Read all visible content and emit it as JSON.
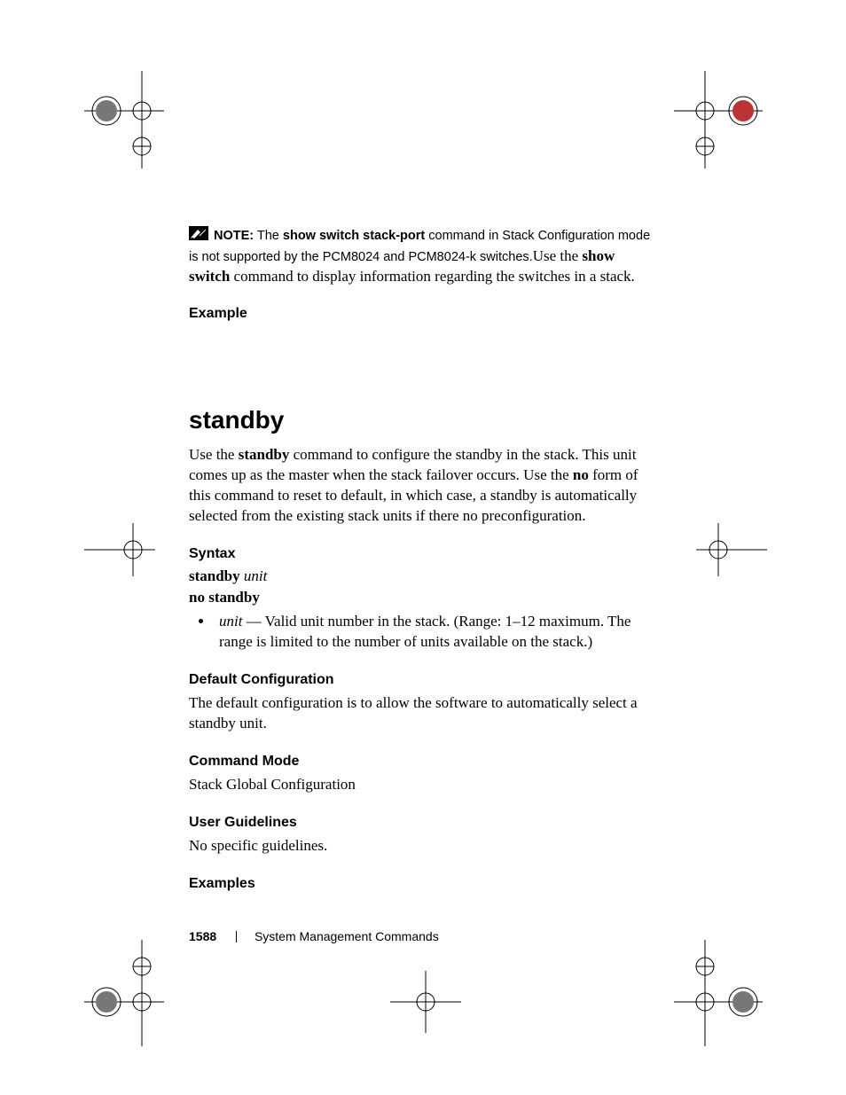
{
  "note": {
    "label": "NOTE:",
    "sans_part1": "The ",
    "bold_cmd": "show switch stack-port",
    "sans_part2": " command in Stack Configuration mode is not supported by the PCM8024 and PCM8024-k switches.",
    "serif_part1": "Use the ",
    "serif_bold": "show switch",
    "serif_part2": " command to display information regarding the switches in a stack."
  },
  "example_heading": "Example",
  "command_heading": "standby",
  "intro": {
    "p1a": "Use the ",
    "p1b_bold": "standby",
    "p1c": " command to configure the standby in the stack. This unit comes up as the master when the stack failover occurs. Use the ",
    "p1d_bold": "no",
    "p1e": " form of this command to reset to default, in which case, a standby is automatically selected from the existing stack units if there no preconfiguration."
  },
  "syntax": {
    "heading": "Syntax",
    "line1_kw": "standby",
    "line1_var": "unit",
    "line2": "no standby",
    "bullet_var": "unit",
    "bullet_rest": " — Valid unit number in the stack. (Range: 1–12 maximum. The range is limited to the number of units available on the stack.)"
  },
  "default_cfg": {
    "heading": "Default Configuration",
    "body": "The default configuration is to allow the software to automatically select a standby unit."
  },
  "cmd_mode": {
    "heading": "Command Mode",
    "body": "Stack Global Configuration"
  },
  "user_guidelines": {
    "heading": "User Guidelines",
    "body": "No specific guidelines."
  },
  "examples_heading": "Examples",
  "footer": {
    "page_number": "1588",
    "section": "System Management Commands"
  }
}
